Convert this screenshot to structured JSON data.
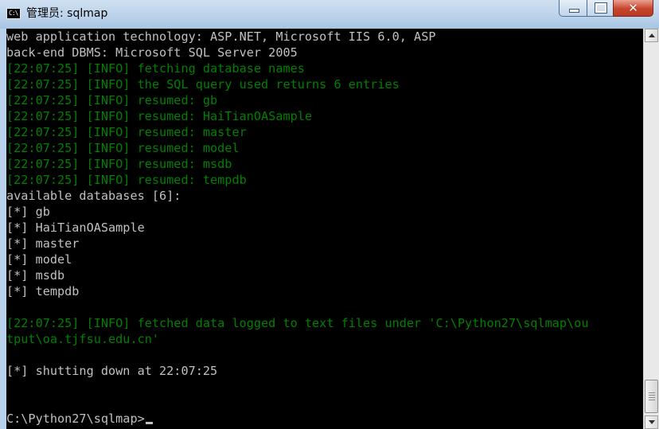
{
  "window": {
    "title": "管理员: sqlmap",
    "icon_text": "C:\\",
    "close_glyph": "✕"
  },
  "colors": {
    "console_bg": "#000000",
    "console_text": "#C0C0C0",
    "info_text": "#008000"
  },
  "console": {
    "lines": [
      {
        "text": "web application technology: ASP.NET, Microsoft IIS 6.0, ASP",
        "style": "normal"
      },
      {
        "text": "back-end DBMS: Microsoft SQL Server 2005",
        "style": "normal"
      },
      {
        "text": "[22:07:25] [INFO] fetching database names",
        "style": "green"
      },
      {
        "text": "[22:07:25] [INFO] the SQL query used returns 6 entries",
        "style": "green"
      },
      {
        "text": "[22:07:25] [INFO] resumed: gb",
        "style": "green"
      },
      {
        "text": "[22:07:25] [INFO] resumed: HaiTianOASample",
        "style": "green"
      },
      {
        "text": "[22:07:25] [INFO] resumed: master",
        "style": "green"
      },
      {
        "text": "[22:07:25] [INFO] resumed: model",
        "style": "green"
      },
      {
        "text": "[22:07:25] [INFO] resumed: msdb",
        "style": "green"
      },
      {
        "text": "[22:07:25] [INFO] resumed: tempdb",
        "style": "green"
      },
      {
        "text": "available databases [6]:",
        "style": "normal"
      },
      {
        "text": "[*] gb",
        "style": "normal"
      },
      {
        "text": "[*] HaiTianOASample",
        "style": "normal"
      },
      {
        "text": "[*] master",
        "style": "normal"
      },
      {
        "text": "[*] model",
        "style": "normal"
      },
      {
        "text": "[*] msdb",
        "style": "normal"
      },
      {
        "text": "[*] tempdb",
        "style": "normal"
      },
      {
        "text": "",
        "style": "normal"
      },
      {
        "text": "[22:07:25] [INFO] fetched data logged to text files under 'C:\\Python27\\sqlmap\\ou",
        "style": "green"
      },
      {
        "text": "tput\\oa.tjfsu.edu.cn'",
        "style": "green"
      },
      {
        "text": "",
        "style": "normal"
      },
      {
        "text": "[*] shutting down at 22:07:25",
        "style": "normal"
      },
      {
        "text": "",
        "style": "normal"
      },
      {
        "text": "",
        "style": "normal"
      }
    ],
    "prompt": "C:\\Python27\\sqlmap>"
  }
}
